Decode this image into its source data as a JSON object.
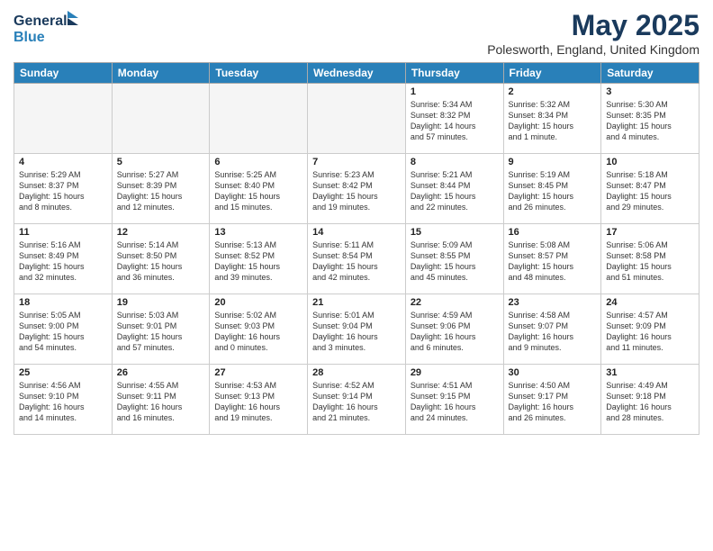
{
  "header": {
    "logo_line1": "General",
    "logo_line2": "Blue",
    "title": "May 2025",
    "location": "Polesworth, England, United Kingdom"
  },
  "weekdays": [
    "Sunday",
    "Monday",
    "Tuesday",
    "Wednesday",
    "Thursday",
    "Friday",
    "Saturday"
  ],
  "weeks": [
    [
      {
        "day": "",
        "empty": true
      },
      {
        "day": "",
        "empty": true
      },
      {
        "day": "",
        "empty": true
      },
      {
        "day": "",
        "empty": true
      },
      {
        "day": "1",
        "info": "Sunrise: 5:34 AM\nSunset: 8:32 PM\nDaylight: 14 hours\nand 57 minutes."
      },
      {
        "day": "2",
        "info": "Sunrise: 5:32 AM\nSunset: 8:34 PM\nDaylight: 15 hours\nand 1 minute."
      },
      {
        "day": "3",
        "info": "Sunrise: 5:30 AM\nSunset: 8:35 PM\nDaylight: 15 hours\nand 4 minutes."
      }
    ],
    [
      {
        "day": "4",
        "info": "Sunrise: 5:29 AM\nSunset: 8:37 PM\nDaylight: 15 hours\nand 8 minutes."
      },
      {
        "day": "5",
        "info": "Sunrise: 5:27 AM\nSunset: 8:39 PM\nDaylight: 15 hours\nand 12 minutes."
      },
      {
        "day": "6",
        "info": "Sunrise: 5:25 AM\nSunset: 8:40 PM\nDaylight: 15 hours\nand 15 minutes."
      },
      {
        "day": "7",
        "info": "Sunrise: 5:23 AM\nSunset: 8:42 PM\nDaylight: 15 hours\nand 19 minutes."
      },
      {
        "day": "8",
        "info": "Sunrise: 5:21 AM\nSunset: 8:44 PM\nDaylight: 15 hours\nand 22 minutes."
      },
      {
        "day": "9",
        "info": "Sunrise: 5:19 AM\nSunset: 8:45 PM\nDaylight: 15 hours\nand 26 minutes."
      },
      {
        "day": "10",
        "info": "Sunrise: 5:18 AM\nSunset: 8:47 PM\nDaylight: 15 hours\nand 29 minutes."
      }
    ],
    [
      {
        "day": "11",
        "info": "Sunrise: 5:16 AM\nSunset: 8:49 PM\nDaylight: 15 hours\nand 32 minutes."
      },
      {
        "day": "12",
        "info": "Sunrise: 5:14 AM\nSunset: 8:50 PM\nDaylight: 15 hours\nand 36 minutes."
      },
      {
        "day": "13",
        "info": "Sunrise: 5:13 AM\nSunset: 8:52 PM\nDaylight: 15 hours\nand 39 minutes."
      },
      {
        "day": "14",
        "info": "Sunrise: 5:11 AM\nSunset: 8:54 PM\nDaylight: 15 hours\nand 42 minutes."
      },
      {
        "day": "15",
        "info": "Sunrise: 5:09 AM\nSunset: 8:55 PM\nDaylight: 15 hours\nand 45 minutes."
      },
      {
        "day": "16",
        "info": "Sunrise: 5:08 AM\nSunset: 8:57 PM\nDaylight: 15 hours\nand 48 minutes."
      },
      {
        "day": "17",
        "info": "Sunrise: 5:06 AM\nSunset: 8:58 PM\nDaylight: 15 hours\nand 51 minutes."
      }
    ],
    [
      {
        "day": "18",
        "info": "Sunrise: 5:05 AM\nSunset: 9:00 PM\nDaylight: 15 hours\nand 54 minutes."
      },
      {
        "day": "19",
        "info": "Sunrise: 5:03 AM\nSunset: 9:01 PM\nDaylight: 15 hours\nand 57 minutes."
      },
      {
        "day": "20",
        "info": "Sunrise: 5:02 AM\nSunset: 9:03 PM\nDaylight: 16 hours\nand 0 minutes."
      },
      {
        "day": "21",
        "info": "Sunrise: 5:01 AM\nSunset: 9:04 PM\nDaylight: 16 hours\nand 3 minutes."
      },
      {
        "day": "22",
        "info": "Sunrise: 4:59 AM\nSunset: 9:06 PM\nDaylight: 16 hours\nand 6 minutes."
      },
      {
        "day": "23",
        "info": "Sunrise: 4:58 AM\nSunset: 9:07 PM\nDaylight: 16 hours\nand 9 minutes."
      },
      {
        "day": "24",
        "info": "Sunrise: 4:57 AM\nSunset: 9:09 PM\nDaylight: 16 hours\nand 11 minutes."
      }
    ],
    [
      {
        "day": "25",
        "info": "Sunrise: 4:56 AM\nSunset: 9:10 PM\nDaylight: 16 hours\nand 14 minutes."
      },
      {
        "day": "26",
        "info": "Sunrise: 4:55 AM\nSunset: 9:11 PM\nDaylight: 16 hours\nand 16 minutes."
      },
      {
        "day": "27",
        "info": "Sunrise: 4:53 AM\nSunset: 9:13 PM\nDaylight: 16 hours\nand 19 minutes."
      },
      {
        "day": "28",
        "info": "Sunrise: 4:52 AM\nSunset: 9:14 PM\nDaylight: 16 hours\nand 21 minutes."
      },
      {
        "day": "29",
        "info": "Sunrise: 4:51 AM\nSunset: 9:15 PM\nDaylight: 16 hours\nand 24 minutes."
      },
      {
        "day": "30",
        "info": "Sunrise: 4:50 AM\nSunset: 9:17 PM\nDaylight: 16 hours\nand 26 minutes."
      },
      {
        "day": "31",
        "info": "Sunrise: 4:49 AM\nSunset: 9:18 PM\nDaylight: 16 hours\nand 28 minutes."
      }
    ]
  ]
}
